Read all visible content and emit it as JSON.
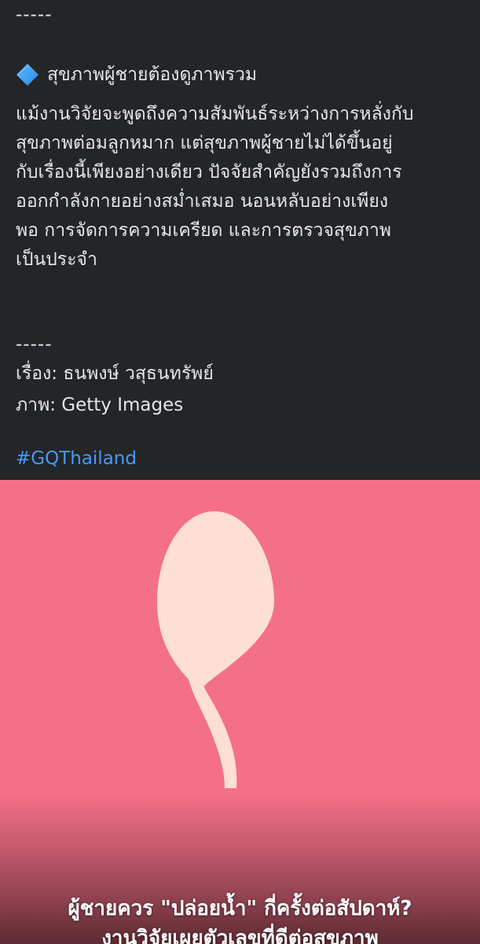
{
  "colors": {
    "background": "#242526",
    "text": "#e4e6eb",
    "hashtag": "#4599ff",
    "image_background": "#f47087",
    "sperm_shape": "#fde0d2",
    "diamond_icon": "#3aa0ff"
  },
  "post": {
    "separator_top": "-----",
    "heading_icon": "blue-diamond-icon",
    "heading": "สุขภาพผู้ชายต้องดูภาพรวม",
    "paragraph_lines": [
      "แม้งานวิจัยจะพูดถึงความสัมพันธ์ระหว่างการหลั่งกับ",
      "สุขภาพต่อมลูกหมาก แต่สุขภาพผู้ชายไม่ได้ขึ้นอยู่",
      "กับเรื่องนี้เพียงอย่างเดียว ปัจจัยสำคัญยังรวมถึงการ",
      "ออกกำลังกายอย่างสม่ำเสมอ นอนหลับอย่างเพียง",
      "พอ การจัดการความเครียด และการตรวจสุขภาพ",
      "เป็นประจำ"
    ],
    "separator_bottom": "-----",
    "author": "เรื่อง: ธนพงษ์ วสุธนทรัพย์",
    "photo_credit": "ภาพ: Getty Images",
    "hashtag": "#GQThailand"
  },
  "image_card": {
    "caption_line_1": "ผู้ชายควร \"ปล่อยน้ำ\" กี่ครั้งต่อสัปดาห์?",
    "caption_line_2": "งานวิจัยเผยตัวเลขที่ดีต่อสุขภาพ"
  }
}
